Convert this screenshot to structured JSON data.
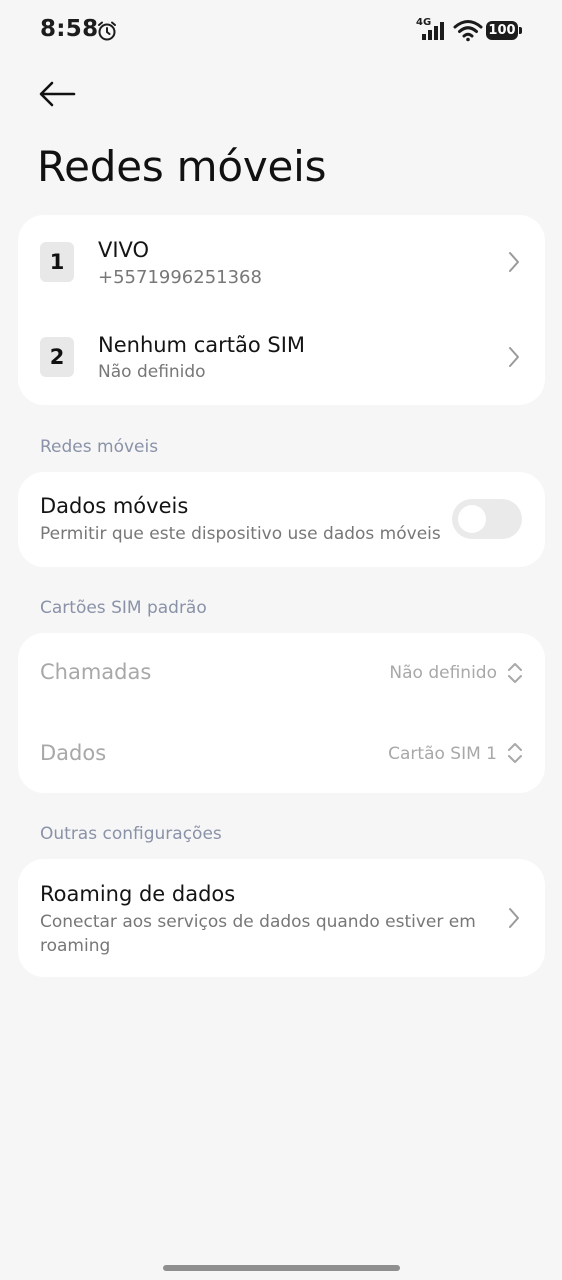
{
  "status_bar": {
    "time": "8:58",
    "network_type": "4G",
    "battery": "100"
  },
  "header": {
    "title": "Redes móveis"
  },
  "sims": [
    {
      "number": "1",
      "name": "VIVO",
      "detail": "+5571996251368"
    },
    {
      "number": "2",
      "name": "Nenhum cartão SIM",
      "detail": "Não definido"
    }
  ],
  "mobile_networks": {
    "section_label": "Redes móveis",
    "mobile_data_title": "Dados móveis",
    "mobile_data_subtitle": "Permitir que este dispositivo use dados móveis",
    "mobile_data_enabled": false
  },
  "default_sims": {
    "section_label": "Cartões SIM padrão",
    "calls_label": "Chamadas",
    "calls_value": "Não definido",
    "data_label": "Dados",
    "data_value": "Cartão SIM 1"
  },
  "other_settings": {
    "section_label": "Outras configurações",
    "roaming_title": "Roaming de dados",
    "roaming_subtitle": "Conectar aos serviços de dados quando estiver em roaming"
  },
  "colors": {
    "background": "#f6f6f6",
    "card": "#ffffff",
    "section_header": "#8a92a8",
    "disabled_text": "#a8a8a8"
  }
}
